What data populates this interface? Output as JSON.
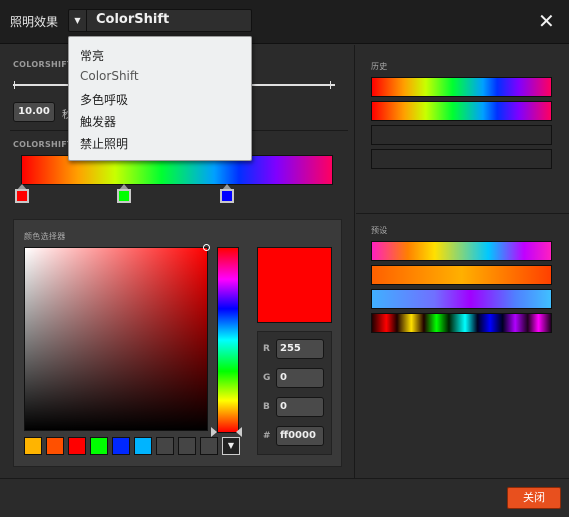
{
  "header": {
    "title": "照明效果",
    "mode_value": "ColorShift",
    "mode_caret": "▼",
    "close_label": "✕"
  },
  "dropdown": {
    "items": [
      "常亮",
      "ColorShift",
      "多色呼吸",
      "触发器",
      "禁止照明"
    ]
  },
  "colorshift": {
    "section_label": "COLORSHIFT",
    "speed_value": "10.00",
    "speed_unit": "秒",
    "gradient_label": "COLORSHIFT"
  },
  "gradient_stops": [
    {
      "color": "#ff0000"
    },
    {
      "color": "#00ff00"
    },
    {
      "color": "#0000ff"
    }
  ],
  "picker": {
    "label": "颜色选择器",
    "current_color": "#ff0000",
    "r_label": "R",
    "r_value": "255",
    "g_label": "G",
    "g_value": "0",
    "b_label": "B",
    "b_value": "0",
    "hex_label": "#",
    "hex_value": "ff0000",
    "palette": [
      "#ffb400",
      "#ff5000",
      "#ff0000",
      "#00ff00",
      "#0028ff",
      "#00b4ff",
      "#454545",
      "#454545",
      "#454545"
    ],
    "more_icon": "▼"
  },
  "history": {
    "label": "历史"
  },
  "presets": {
    "label": "预设"
  },
  "footer": {
    "save_label": "关闭"
  }
}
